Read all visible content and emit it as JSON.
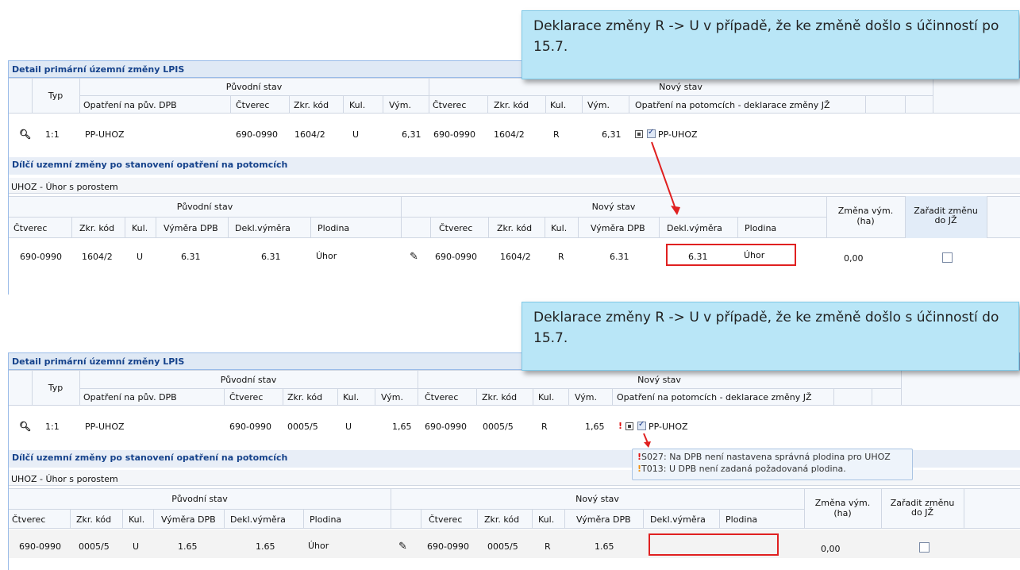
{
  "top": {
    "callout": "Deklarace změny R -> U v případě, že ke změně došlo s účinností po 15.7.",
    "panel_title": "Detail primární územní změny LPIS",
    "header": {
      "typ": "Typ",
      "puvodni": "Původní stav",
      "novy": "Nový stav",
      "opatreni_puv": "Opatření na pův. DPB",
      "ctverec": "Čtverec",
      "zkr_kod": "Zkr. kód",
      "kul": "Kul.",
      "vym": "Vým.",
      "opatreni_pot": "Opatření na potomcích - deklarace změny JŽ"
    },
    "row": {
      "typ": "1:1",
      "opatreni": "PP-UHOZ",
      "ctverec": "690-0990",
      "zkr_kod": "1604/2",
      "kul": "U",
      "vym": "6,31",
      "n_ctverec": "690-0990",
      "n_zkr_kod": "1604/2",
      "n_kul": "R",
      "n_vym": "6,31",
      "n_opatreni": "PP-UHOZ"
    },
    "sub_title": "Dílčí uzemní změny po stanovení opatření na potomcích",
    "group": "UHOZ - Úhor s porostem",
    "sub_header": {
      "puvodni": "Původní stav",
      "novy": "Nový stav",
      "ctverec": "Čtverec",
      "zkr_kod": "Zkr. kód",
      "kul": "Kul.",
      "vymera_dpb": "Výměra DPB",
      "dekl_vymera": "Dekl.výměra",
      "plodina": "Plodina",
      "zmena_vym": "Změna vým.",
      "zmena_vym_unit": "(ha)",
      "zaradit": "Zařadit změnu",
      "zaradit2": "do JŽ"
    },
    "sub_row": {
      "ctverec": "690-0990",
      "zkr_kod": "1604/2",
      "kul": "U",
      "vymera_dpb": "6.31",
      "dekl_vymera": "6.31",
      "plodina": "Úhor",
      "n_ctverec": "690-0990",
      "n_zkr_kod": "1604/2",
      "n_kul": "R",
      "n_vymera_dpb": "6.31",
      "n_dekl_vymera": "6.31",
      "n_plodina": "Úhor",
      "zmena": "0,00"
    }
  },
  "bottom": {
    "callout": "Deklarace změny R -> U v případě, že ke změně došlo s účinností do 15.7.",
    "panel_title": "Detail primární územní změny LPIS",
    "header": {
      "typ": "Typ",
      "puvodni": "Původní stav",
      "novy": "Nový stav",
      "opatreni_puv": "Opatření na pův. DPB",
      "ctverec": "Čtverec",
      "zkr_kod": "Zkr. kód",
      "kul": "Kul.",
      "vym": "Vým.",
      "opatreni_pot": "Opatření na potomcích - deklarace změny JŽ"
    },
    "row": {
      "typ": "1:1",
      "opatreni": "PP-UHOZ",
      "ctverec": "690-0990",
      "zkr_kod": "0005/5",
      "kul": "U",
      "vym": "1,65",
      "n_ctverec": "690-0990",
      "n_zkr_kod": "0005/5",
      "n_kul": "R",
      "n_vym": "1,65",
      "n_opatreni": "PP-UHOZ"
    },
    "tooltip": {
      "line1": "S027: Na DPB není nastavena správná plodina pro UHOZ",
      "line2": "T013: U DPB není zadaná požadovaná plodina."
    },
    "sub_title": "Dílčí uzemní změny po stanovení opatření na potomcích",
    "group": "UHOZ - Úhor s porostem",
    "sub_header": {
      "puvodni": "Původní stav",
      "novy": "Nový stav",
      "ctverec": "Čtverec",
      "zkr_kod": "Zkr. kód",
      "kul": "Kul.",
      "vymera_dpb": "Výměra DPB",
      "dekl_vymera": "Dekl.výměra",
      "plodina": "Plodina",
      "zmena_vym": "Změna vým.",
      "zmena_vym_unit": "(ha)",
      "zaradit": "Zařadit změnu",
      "zaradit2": "do JŽ"
    },
    "sub_row": {
      "ctverec": "690-0990",
      "zkr_kod": "0005/5",
      "kul": "U",
      "vymera_dpb": "1.65",
      "dekl_vymera": "1.65",
      "plodina": "Úhor",
      "n_ctverec": "690-0990",
      "n_zkr_kod": "0005/5",
      "n_kul": "R",
      "n_vymera_dpb": "1.65",
      "zmena": "0,00"
    }
  },
  "colors": {
    "accent": "#15428b",
    "error": "#e02020",
    "callout_bg": "#b9e6f7"
  }
}
